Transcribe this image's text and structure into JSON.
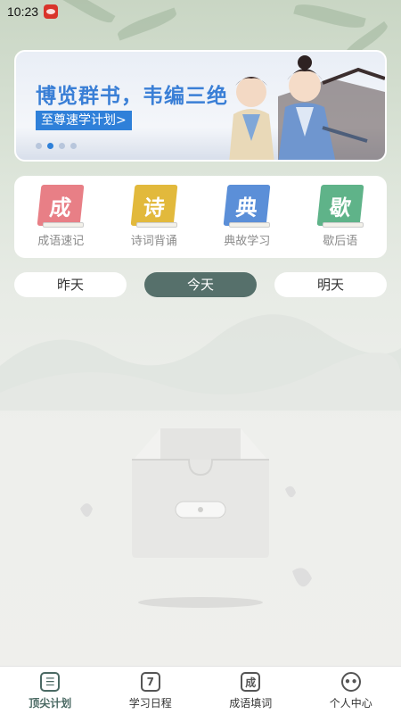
{
  "status_bar": {
    "time": "10:23"
  },
  "banner": {
    "title": "博览群书，韦编三绝",
    "button_label": "至尊速学计划>",
    "page_count": 4,
    "active_page": 1
  },
  "categories": [
    {
      "glyph": "成",
      "label": "成语速记",
      "color": "#e87f86"
    },
    {
      "glyph": "诗",
      "label": "诗词背诵",
      "color": "#e2b93c"
    },
    {
      "glyph": "典",
      "label": "典故学习",
      "color": "#5b8fd8"
    },
    {
      "glyph": "歇",
      "label": "歇后语",
      "color": "#5fb389"
    }
  ],
  "day_tabs": [
    {
      "label": "昨天",
      "active": false
    },
    {
      "label": "今天",
      "active": true
    },
    {
      "label": "明天",
      "active": false
    }
  ],
  "bottom_nav": [
    {
      "label": "顶尖计划",
      "icon": "list-icon",
      "glyph": "☰",
      "active": true
    },
    {
      "label": "学习日程",
      "icon": "calendar-icon",
      "glyph": "7",
      "active": false
    },
    {
      "label": "成语填词",
      "icon": "idiom-icon",
      "glyph": "成",
      "active": false
    },
    {
      "label": "个人中心",
      "icon": "profile-icon",
      "glyph": "••",
      "active": false
    }
  ],
  "colors": {
    "accent": "#56706b",
    "banner_blue": "#2f80d9"
  }
}
